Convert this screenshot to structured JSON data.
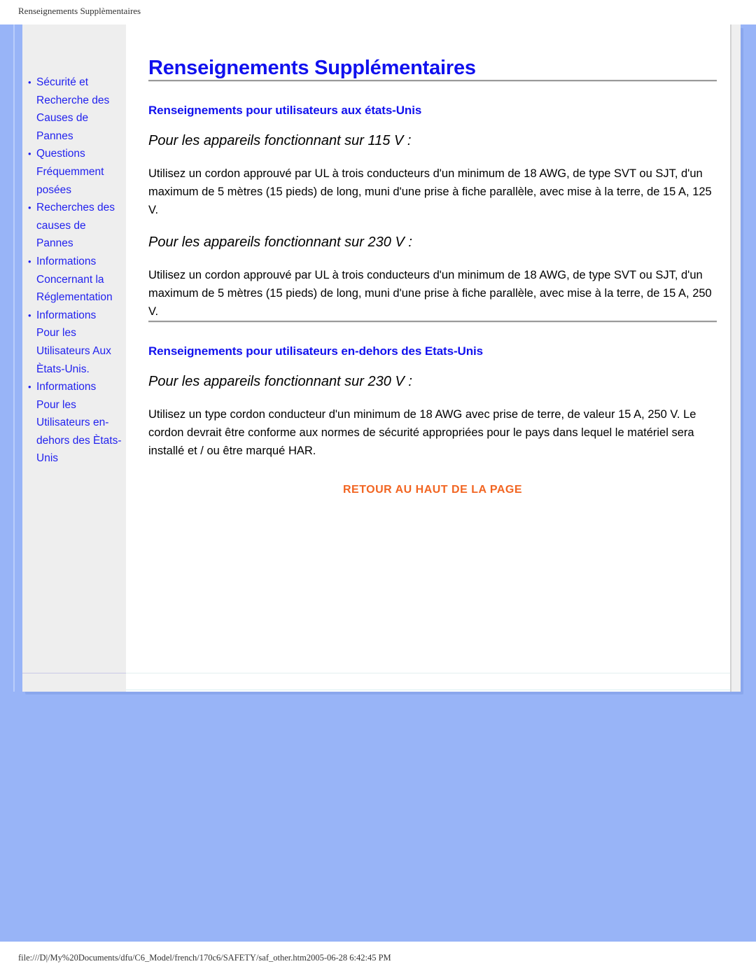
{
  "print_header": {
    "title": "Renseignements Supplèmentaires"
  },
  "print_footer": {
    "path_and_timestamp": "file:///D|/My%20Documents/dfu/C6_Model/french/170c6/SAFETY/saf_other.htm2005-06-28 6:42:45 PM"
  },
  "colors": {
    "page_background": "#98b4f7",
    "sidebar_background": "#eeeeee",
    "link_blue": "#2222ee",
    "heading_blue": "#1111ee",
    "accent_orange": "#f26522",
    "rule_gray": "#9a9a9a"
  },
  "sidebar": {
    "bullet_glyph": "•",
    "items": [
      {
        "label": "Sécurité et Recherche des Causes de Pannes"
      },
      {
        "label": "Questions Fréquemment posées"
      },
      {
        "label": "Recherches des causes de Pannes"
      },
      {
        "label": "Informations Concernant la Réglementation"
      },
      {
        "label": "Informations Pour les Utilisateurs Aux Ètats-Unis."
      },
      {
        "label": "Informations Pour les Utilisateurs en-dehors des Ètats-Unis"
      }
    ]
  },
  "main": {
    "page_title": "Renseignements Supplémentaires",
    "section_us": {
      "heading": "Renseignements pour utilisateurs aux états-Unis",
      "sub_heading_115": "Pour les appareils fonctionnant sur 115 V :",
      "body_115": "Utilisez un cordon approuvé par UL à trois conducteurs d'un minimum de 18 AWG, de type SVT ou SJT, d'un maximum de 5 mètres (15 pieds) de long, muni d'une prise à fiche parallèle, avec mise à la terre, de 15 A, 125 V.",
      "sub_heading_230": "Pour les appareils fonctionnant sur 230 V :",
      "body_230": "Utilisez un cordon approuvé par UL à trois conducteurs d'un minimum de 18 AWG, de type SVT ou SJT, d'un maximum de 5 mètres (15 pieds) de long, muni d'une prise à fiche parallèle, avec mise à la terre, de 15 A, 250 V."
    },
    "section_outside_us": {
      "heading": "Renseignements pour utilisateurs en-dehors des Etats-Unis",
      "sub_heading_230": "Pour les appareils fonctionnant sur 230 V :",
      "body_230": "Utilisez un type cordon conducteur d'un minimum de 18 AWG avec prise de terre, de valeur 15 A, 250 V. Le cordon devrait être conforme aux normes de sécurité appropriées pour le pays dans lequel le matériel sera installé et / ou être marqué HAR."
    },
    "back_to_top_label": "RETOUR AU HAUT DE LA PAGE"
  }
}
